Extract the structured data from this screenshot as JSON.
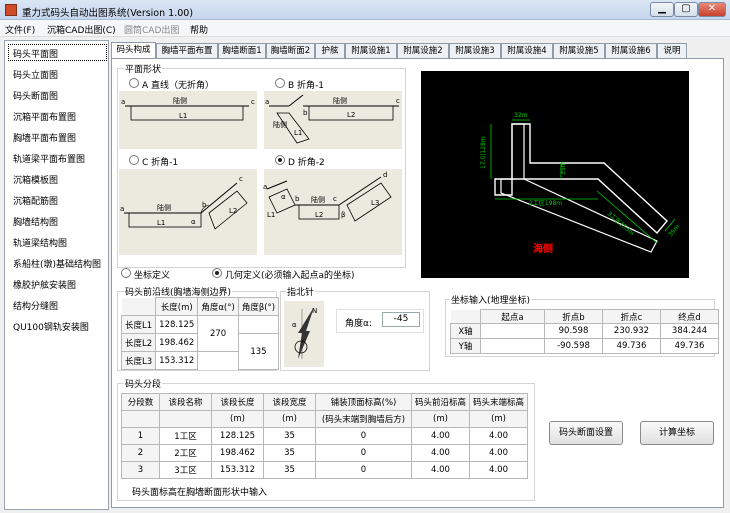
{
  "window": {
    "title": "重力式码头自动出图系统(Version 1.00)",
    "min": "▁",
    "max": "▢",
    "close": "✕"
  },
  "menu": [
    "文件(F)",
    "沉箱CAD出图(C)",
    "圆筒CAD出图",
    "帮助"
  ],
  "nav": [
    "码头平面图",
    "码头立面图",
    "码头断面图",
    "沉箱平面布置图",
    "胸墙平面布置图",
    "轨道梁平面布置图",
    "沉箱模板图",
    "沉箱配筋图",
    "胸墙结构图",
    "轨道梁结构图",
    "系船柱(墩)基础结构图",
    "橡胶护舷安装图",
    "结构分缝图",
    "QU100钢轨安装图"
  ],
  "tabs": [
    "码头构成",
    "胸墙平面布置",
    "胸墙断面1",
    "胸墙断面2",
    "护舷",
    "附属设施1",
    "附属设施2",
    "附属设施3",
    "附属设施4",
    "附属设施5",
    "附属设施6",
    "说明"
  ],
  "shape": {
    "group": "平面形状",
    "options": [
      "A 直线（无折角）",
      "B 折角-1",
      "C 折角-1",
      "D 折角-2"
    ],
    "selected": 3,
    "diag": {
      "lu": "陆侧",
      "hai": "海侧",
      "L1": "L1",
      "L2": "L2",
      "L3": "L3",
      "a": "a",
      "b": "b",
      "c": "c",
      "d": "d",
      "alpha": "α",
      "beta": "β"
    }
  },
  "preview": {
    "dim1": "32m",
    "dim2": "17.0|128m",
    "dim3": "35m",
    "dim4": "2工区198m",
    "dim5": "3工区153m",
    "dim6": "35m",
    "sea": "海侧"
  },
  "define": {
    "options": [
      "坐标定义",
      "几何定义(必须输入起点a的坐标)"
    ],
    "selected": 1
  },
  "front": {
    "group": "码头前沿线(胸墙海侧边界)",
    "headers": [
      "长度(m)",
      "角度α(°)",
      "角度β(°)"
    ],
    "rows": [
      {
        "label": "长度L1",
        "len": "128.125"
      },
      {
        "label": "长度L2",
        "len": "198.462"
      },
      {
        "label": "长度L3",
        "len": "153.312"
      }
    ],
    "alpha": "270",
    "beta": "135"
  },
  "north": {
    "group": "指北针",
    "angle_label": "角度α:",
    "angle_value": "-45",
    "N": "N",
    "alpha": "α"
  },
  "coords": {
    "group": "坐标输入(地理坐标)",
    "headers": [
      "起点a",
      "折点b",
      "折点c",
      "终点d"
    ],
    "rows": [
      {
        "axis": "X轴",
        "vals": [
          "",
          "90.598",
          "230.932",
          "384.244"
        ]
      },
      {
        "axis": "Y轴",
        "vals": [
          "",
          "-90.598",
          "49.736",
          "49.736"
        ]
      }
    ]
  },
  "seg": {
    "group": "码头分段",
    "headers1": [
      "分段数",
      "该段名称",
      "该段长度",
      "该段宽度",
      "铺装顶面标高(%)",
      "码头前沿标高",
      "码头末端标高"
    ],
    "headers2": [
      "",
      "",
      "(m)",
      "(m)",
      "(码头末端到胸墙后方)",
      "(m)",
      "(m)"
    ],
    "rows": [
      [
        "1",
        "1工区",
        "128.125",
        "35",
        "0",
        "4.00",
        "4.00"
      ],
      [
        "2",
        "2工区",
        "198.462",
        "35",
        "0",
        "4.00",
        "4.00"
      ],
      [
        "3",
        "3工区",
        "153.312",
        "35",
        "0",
        "4.00",
        "4.00"
      ]
    ],
    "note": "码头面标高在胸墙断面形状中输入"
  },
  "buttons": {
    "section": "码头断面设置",
    "calc": "计算坐标"
  }
}
